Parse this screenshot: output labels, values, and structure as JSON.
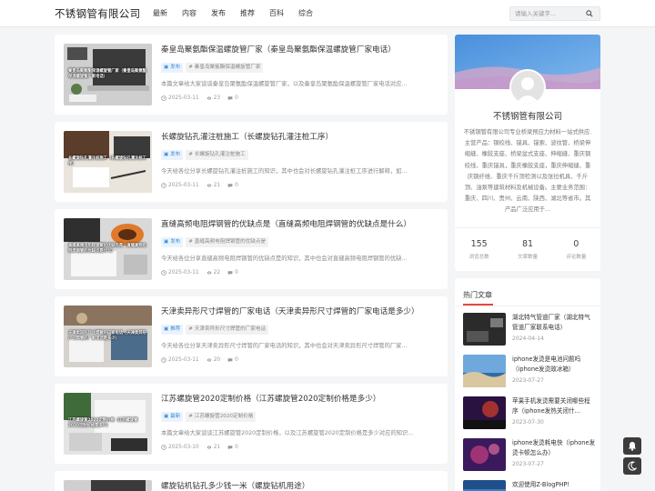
{
  "header": {
    "logo": "不锈钢管有限公司",
    "nav": [
      "最新",
      "内容",
      "发布",
      "推荐",
      "百科",
      "综合"
    ],
    "search_placeholder": "请输入关键字..."
  },
  "articles": [
    {
      "title": "秦皇岛聚氨酯保温螺旋管厂家（秦皇岛聚氨酯保温螺旋管厂家电话）",
      "category": "发布",
      "keyword": "秦皇岛聚氨酯保温螺旋管厂家",
      "excerpt": "本篇文章给大家谈谈秦皇岛聚氨酯保温螺旋管厂家，以及秦皇岛聚氨酯保温螺旋管厂家电话对应...",
      "date": "2025-03-11",
      "views": "23",
      "comments": "0",
      "thumb_caption": "秦皇岛聚氨酯保温螺旋管厂家（秦皇岛聚氨酯保温螺旋管厂家电话）",
      "thumb_style": "laptop"
    },
    {
      "title": "长螺旋钻孔灌注桩施工（长螺旋钻孔灌注桩工序）",
      "category": "发布",
      "keyword": "长螺旋钻孔灌注桩施工",
      "excerpt": "今天给各位分享长螺旋钻孔灌注桩施工的知识，其中也会对长螺旋钻孔灌注桩工序进行解释，如...",
      "date": "2025-03-11",
      "views": "21",
      "comments": "0",
      "thumb_caption": "长螺旋钻孔灌注桩施工（长螺旋钻孔灌注桩工序）",
      "thumb_style": "desk"
    },
    {
      "title": "直缝高频电阻焊钢管的优缺点是（直缝高频电阻焊钢管的优缺点是什么）",
      "category": "发布",
      "keyword": "直缝高频电阻焊钢管的优缺点是",
      "excerpt": "今天给各位分享直缝高频电阻焊钢管的优缺点是的知识，其中也会对直缝高频电阻焊钢管的优缺...",
      "date": "2025-03-11",
      "views": "22",
      "comments": "0",
      "thumb_caption": "直缝高频电阻焊钢管的优缺点是（直缝高频电阻焊钢管的优缺点是什么）",
      "thumb_style": "coffee"
    },
    {
      "title": "天津卖异形尺寸焊管的厂家电话（天津卖异形尺寸焊管的厂家电话是多少）",
      "category": "推荐",
      "keyword": "天津卖异形尺寸焊管的厂家电话",
      "excerpt": "今天给各位分享天津卖异形尺寸焊管的厂家电话的知识，其中也会对天津卖异形尺寸焊管的厂家...",
      "date": "2025-03-11",
      "views": "20",
      "comments": "0",
      "thumb_caption": "天津卖异形尺寸焊管的厂家电话（天津卖异形尺寸焊管的厂家电话是多少）",
      "thumb_style": "workspace"
    },
    {
      "title": "江苏螺旋管2020定制价格（江苏螺旋管2020定制价格是多少）",
      "category": "最新",
      "keyword": "江苏螺旋管2020定制价格",
      "excerpt": "本篇文章给大家谈谈江苏螺旋管2020定制价格，以及江苏螺旋管2020定制价格是多少对应的知识...",
      "date": "2025-03-10",
      "views": "21",
      "comments": "0",
      "thumb_caption": "江苏螺旋管2020定制价格（江苏螺旋管2020定制价格是多少）",
      "thumb_style": "notebook"
    },
    {
      "title": "螺旋钻机钻孔多少钱一米（螺旋钻机用途）"
    }
  ],
  "profile": {
    "name": "不锈钢管有限公司",
    "description": "不锈钢管有限公司专业桥梁预应力材料一站式供应.主营产品：钢绞线、锚具、锚索、波纹管、桥梁伸缩缝、橡胶支座、桥梁盆式支座、伸缩缝、重庆钢绞线、重庆锚具，重庆橡胶支座，重庆伸缩缝、重庆钢纤维、重庆千斤顶检测以及张拉机具、千斤顶、油泵等建筑材料及机械设备。主要业务范围：重庆、四川、贵州、云南、陕西、湖北等省市。其产品广泛应用于...",
    "stats": [
      {
        "num": "155",
        "label": "浏览总数"
      },
      {
        "num": "81",
        "label": "文章数量"
      },
      {
        "num": "0",
        "label": "评论数量"
      }
    ]
  },
  "hot": {
    "title": "热门文章",
    "items": [
      {
        "text": "湖北特气管道厂家（湖北特气管道厂家联系电话）",
        "date": "2024-04-14",
        "thumb_style": "dark-desk"
      },
      {
        "text": "iphone发烫是电池问题吗（iphone发烫故冰箱）",
        "date": "2023-07-27",
        "thumb_style": "sea"
      },
      {
        "text": "苹果手机发烫需要关闭哪些程序（iphone发热关闭什...",
        "date": "2023-07-30",
        "thumb_style": "night"
      },
      {
        "text": "iphone发烫耗电快（iphone发烫卡顿怎么办）",
        "date": "2023-07-27",
        "thumb_style": "purple"
      },
      {
        "text": "欢迎使用Z-BlogPHP!",
        "date": "",
        "thumb_style": "blue"
      }
    ]
  },
  "colors": {
    "accent_red": "#e8453c",
    "tag_blue": "#3b8cd9",
    "banner_blue": "#5aa0e6"
  }
}
